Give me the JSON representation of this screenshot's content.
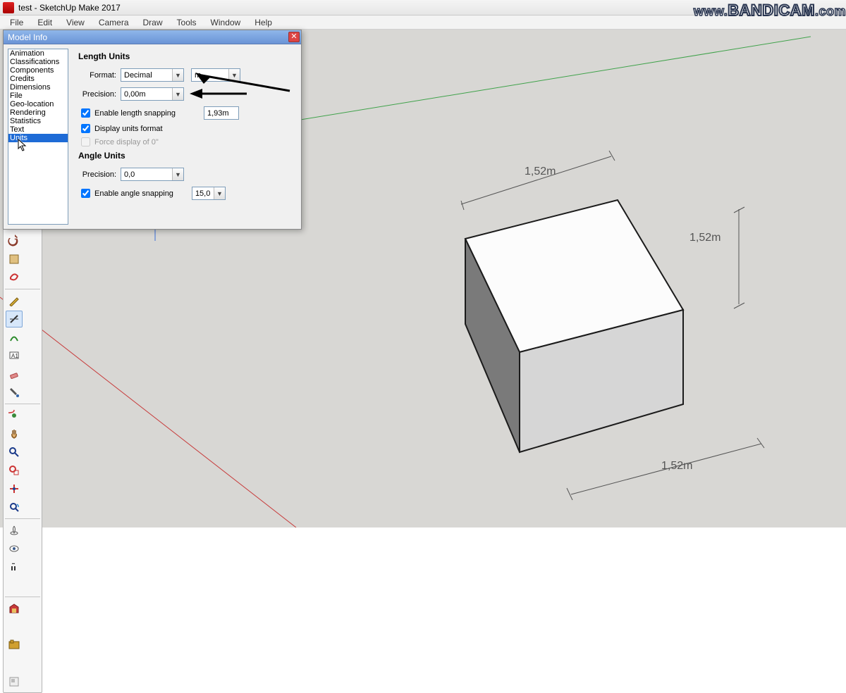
{
  "title": "test - SketchUp Make 2017",
  "menubar": [
    "File",
    "Edit",
    "View",
    "Camera",
    "Draw",
    "Tools",
    "Window",
    "Help"
  ],
  "bandicam": "www.BANDICAM.com",
  "dialog": {
    "title": "Model Info",
    "categories": [
      "Animation",
      "Classifications",
      "Components",
      "Credits",
      "Dimensions",
      "File",
      "Geo-location",
      "Rendering",
      "Statistics",
      "Text",
      "Units"
    ],
    "selected": "Units",
    "length_units": {
      "header": "Length Units",
      "format_label": "Format:",
      "format_value": "Decimal",
      "unit_value": "m",
      "precision_label": "Precision:",
      "precision_value": "0,00m",
      "enable_snap_label": "Enable length snapping",
      "enable_snap_checked": true,
      "snap_value": "1,93m",
      "display_units_label": "Display units format",
      "display_units_checked": true,
      "force_zero_label": "Force display of 0\"",
      "force_zero_checked": false
    },
    "angle_units": {
      "header": "Angle Units",
      "precision_label": "Precision:",
      "precision_value": "0,0",
      "enable_snap_label": "Enable angle snapping",
      "enable_snap_checked": true,
      "snap_value": "15,0"
    }
  },
  "dims": {
    "top": "1,52m",
    "right": "1,52m",
    "bottom": "1,52m"
  }
}
